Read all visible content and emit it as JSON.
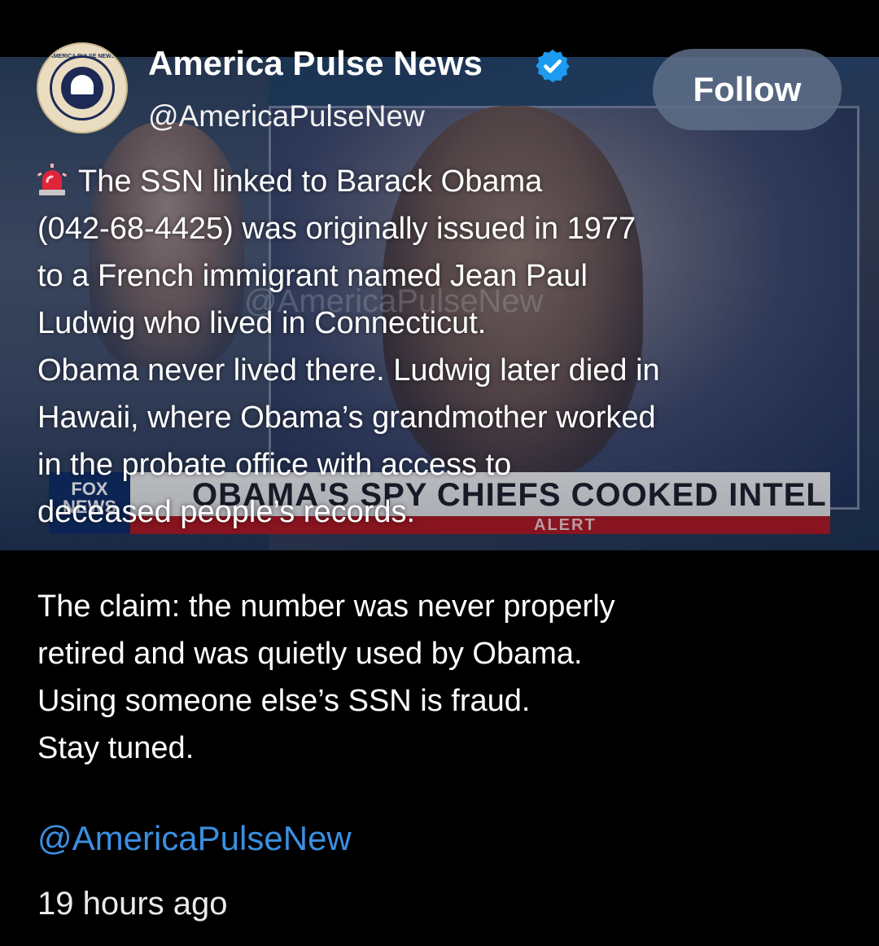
{
  "account": {
    "name": "America Pulse News",
    "handle": "@AmericaPulseNew",
    "verified": true,
    "avatar_label": "AMERICA PULSE NEWS"
  },
  "follow_button": {
    "label": "Follow"
  },
  "post": {
    "siren_icon": "police-siren-icon",
    "line1": "The SSN linked to Barack Obama",
    "body_top": "(042-68-4425) was originally issued in 1977\nto a French immigrant named Jean Paul\nLudwig who lived in Connecticut.\nObama never lived there. Ludwig later died in\nHawaii, where Obama’s grandmother worked\nin the probate office with access to\ndeceased people’s records.",
    "body_bottom": "The claim: the number was never properly\nretired and was quietly used by Obama.\nUsing someone else’s SSN is fraud.\nStay tuned.",
    "mention": "@AmericaPulseNew",
    "timestamp": "19 hours ago"
  },
  "media": {
    "channel_logo": "FOX NEWS",
    "headline": "OBAMA'S SPY CHIEFS COOKED INTEL",
    "banner": "ALERT",
    "watermark": "@AmericaPulseNew"
  },
  "colors": {
    "background": "#000000",
    "link": "#3b8fe0",
    "verified": "#1d9bf0",
    "follow_button_bg": "#5f6e87"
  }
}
